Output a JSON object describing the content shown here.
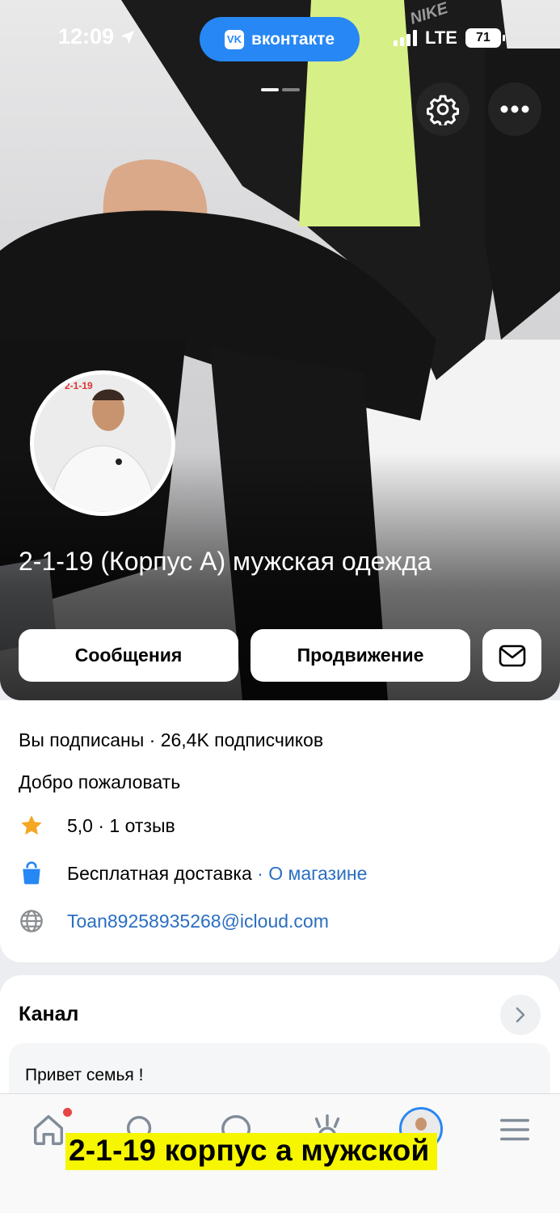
{
  "status_bar": {
    "time": "12:09",
    "app_pill": "вконтакте",
    "app_logo": "VK",
    "network": "LTE",
    "battery": "71"
  },
  "header": {
    "title": "2-1-19 (Корпус А) мужская одежда",
    "avatar_tag": "2-1-19",
    "photo_brand": "NIKE",
    "buttons": {
      "messages": "Сообщения",
      "promotion": "Продвижение"
    }
  },
  "info": {
    "subscription": "Вы подписаны · 26,4K подписчиков",
    "welcome": "Добро пожаловать",
    "rating": "5,0 · 1 отзыв",
    "delivery": "Бесплатная доставка",
    "delivery_sep": " · ",
    "about_store": "О магазине",
    "email": "Toan89258935268@icloud.com"
  },
  "channel": {
    "title": "Канал",
    "post_preview": "Привет семья !"
  },
  "caption": "2-1-19 корпус а мужской",
  "colors": {
    "accent": "#2787f5",
    "link": "#2a6ec2",
    "star": "#f5a623",
    "notification": "#e64646",
    "caption_bg": "#f6f600"
  },
  "icons": {
    "location": "location-arrow-icon",
    "settings": "gear-icon",
    "more": "more-horizontal-icon",
    "mail": "envelope-icon",
    "star": "star-icon",
    "shop": "shopping-bag-icon",
    "globe": "globe-icon",
    "chevron": "chevron-right-icon",
    "home": "home-icon",
    "search": "search-icon",
    "messages": "chat-icon",
    "clips": "clips-icon",
    "menu": "hamburger-menu-icon"
  }
}
